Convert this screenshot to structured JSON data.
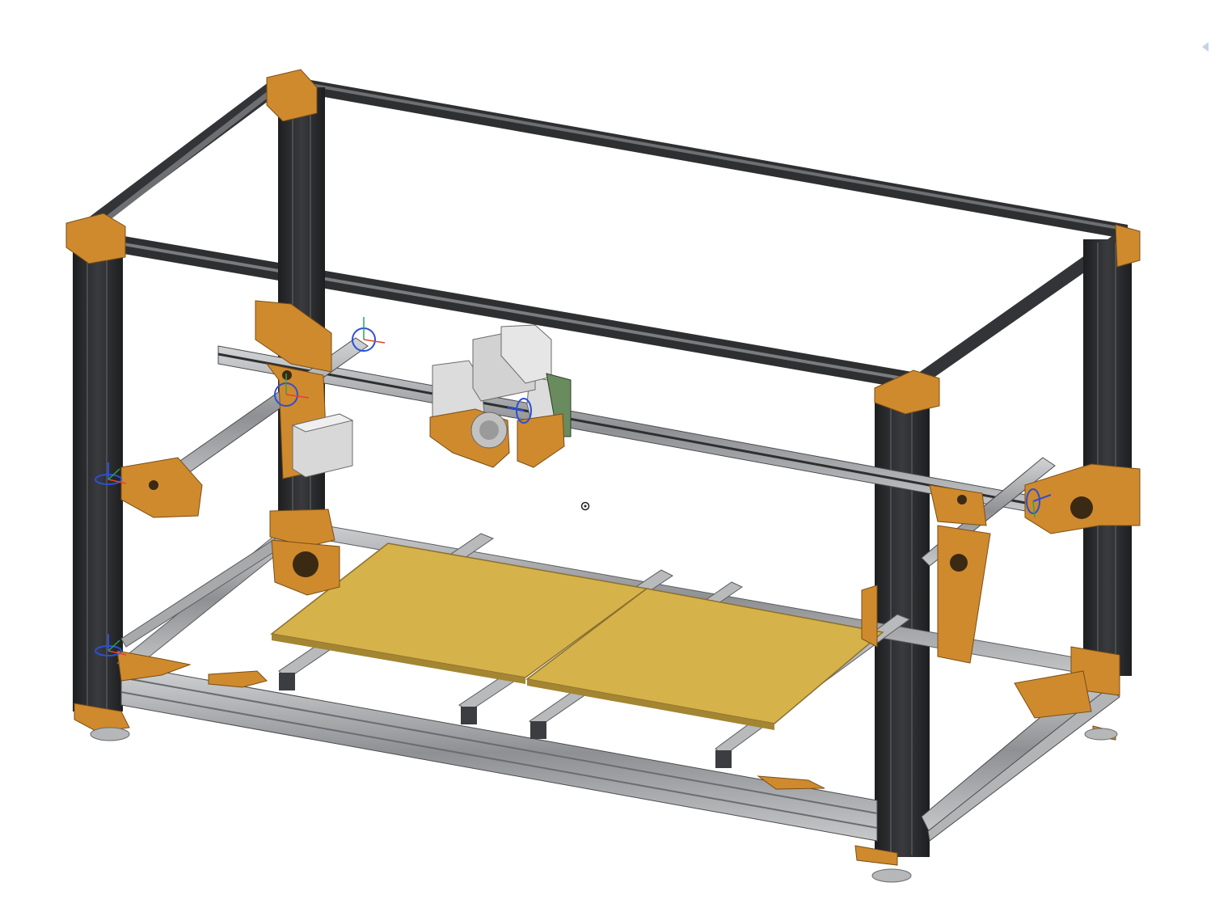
{
  "app": {
    "view": "3d-model-viewport",
    "panel_toggle_icon": "chevron-left-icon"
  },
  "colors": {
    "background": "#ffffff",
    "extrusion_black": "#2e2f31",
    "extrusion_silver": "#a7a9ab",
    "printed_parts": "#cf8a2e",
    "bed": "#d6b24a",
    "toolhead": "#dcdcdc",
    "motor": "#d8d8d8",
    "axis_x": "#e0452a",
    "axis_y": "#2fa44f",
    "axis_z": "#2b4fd8"
  },
  "scene": {
    "mate_connectors": [
      {
        "name": "mate-connector-gantry-left-top"
      },
      {
        "name": "mate-connector-gantry-left-carriage"
      },
      {
        "name": "mate-connector-toolhead"
      },
      {
        "name": "mate-connector-right-rod"
      },
      {
        "name": "mate-connector-left-mid"
      },
      {
        "name": "mate-connector-left-bottom"
      }
    ],
    "rotation_center_icon": "target-icon"
  }
}
